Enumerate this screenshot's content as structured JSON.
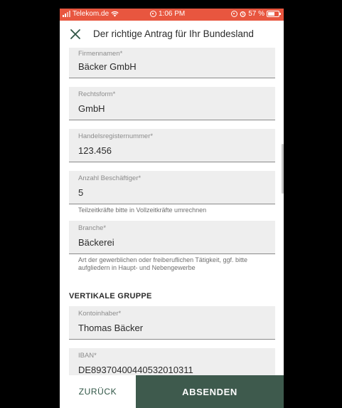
{
  "status_bar": {
    "carrier": "Telekom.de",
    "time": "1:06 PM",
    "battery": "57 %",
    "bar_color": "#e8563f"
  },
  "header": {
    "title": "Der richtige Antrag für Ihr Bundesland",
    "close_icon": "close-icon"
  },
  "form": {
    "fields": [
      {
        "label": "Firmennamen*",
        "value": "Bäcker GmbH"
      },
      {
        "label": "Rechtsform*",
        "value": "GmbH"
      },
      {
        "label": "Handelsregisternummer*",
        "value": "123.456"
      },
      {
        "label": "Anzahl Beschäftiger*",
        "value": "5",
        "hint": "Teilzeitkräfte bitte in Vollzeitkräfte umrechnen"
      },
      {
        "label": "Branche*",
        "value": "Bäckerei",
        "hint": "Art der gewerblichen oder freiberuflichen Tätigkeit, ggf. bitte aufgliedern in Haupt- und Nebengewerbe"
      },
      {
        "label": "Kontoinhaber*",
        "value": "Thomas Bäcker"
      },
      {
        "label": "IBAN*",
        "value": "DE89370400440532010311"
      }
    ],
    "section_title": "VERTIKALE GRUPPE"
  },
  "footer": {
    "back_label": "ZURÜCK",
    "submit_label": "ABSENDEN",
    "accent": "#3e5a4d"
  }
}
